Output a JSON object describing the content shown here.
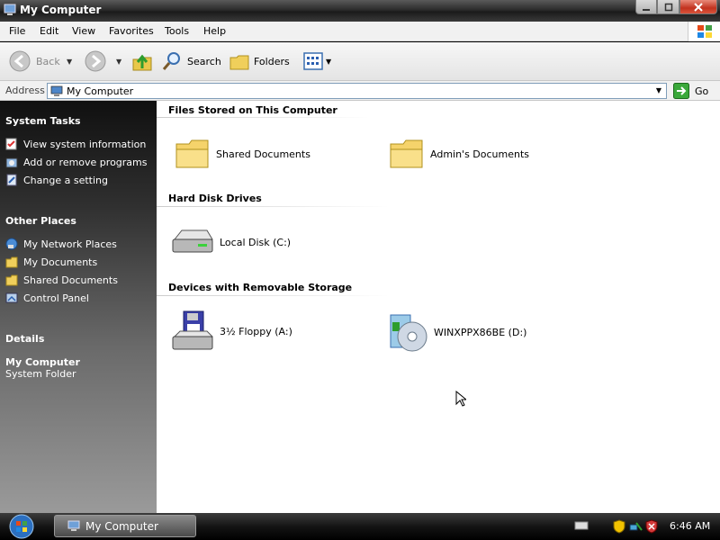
{
  "window": {
    "title": "My Computer"
  },
  "menu": [
    "File",
    "Edit",
    "View",
    "Favorites",
    "Tools",
    "Help"
  ],
  "toolbar": {
    "back": "Back",
    "search": "Search",
    "folders": "Folders"
  },
  "address": {
    "label": "Address",
    "value": "My Computer",
    "go": "Go"
  },
  "taskpane": {
    "system_tasks": {
      "title": "System Tasks",
      "items": [
        "View system information",
        "Add or remove programs",
        "Change a setting"
      ]
    },
    "other_places": {
      "title": "Other Places",
      "items": [
        "My Network Places",
        "My Documents",
        "Shared Documents",
        "Control Panel"
      ]
    },
    "details": {
      "title": "Details",
      "name": "My Computer",
      "type": "System Folder"
    }
  },
  "groups": {
    "files": {
      "title": "Files Stored on This Computer",
      "items": [
        "Shared Documents",
        "Admin's Documents"
      ]
    },
    "hdd": {
      "title": "Hard Disk Drives",
      "items": [
        "Local Disk (C:)"
      ]
    },
    "removable": {
      "title": "Devices with Removable Storage",
      "items": [
        "3½ Floppy (A:)",
        "WINXPPX86BE (D:)"
      ]
    }
  },
  "taskbar": {
    "task": "My Computer",
    "clock": "6:46 AM"
  },
  "colors": {
    "accent_link": "#1a5fb4",
    "folder": "#f5d36b",
    "close": "#c2321e"
  }
}
